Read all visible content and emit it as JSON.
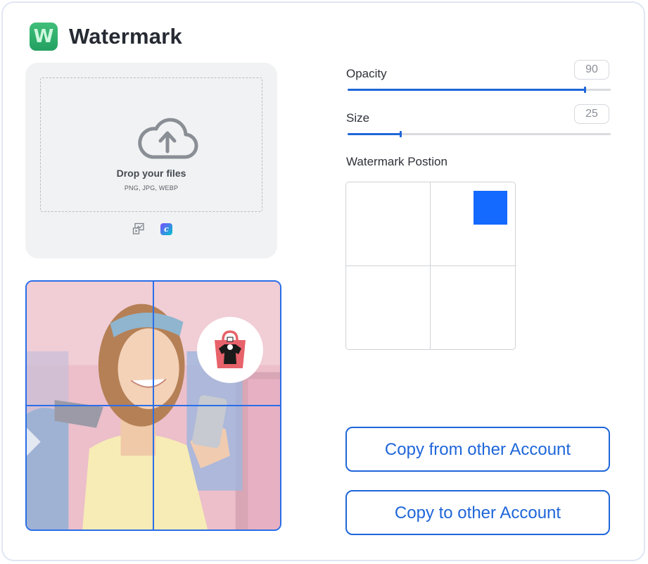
{
  "app": {
    "title": "Watermark",
    "logo_letter": "W",
    "logo_color": "#2eae6c"
  },
  "upload": {
    "title": "Drop your files",
    "formats": "PNG, JPG, WEBP",
    "icons": [
      "cloud-upload-icon",
      "media-library-icon",
      "canva-icon"
    ],
    "canva_letter": "c"
  },
  "preview": {
    "accent": "#2a6ee8"
  },
  "opacity": {
    "label": "Opacity",
    "value": "90",
    "fraction": 0.9
  },
  "size": {
    "label": "Size",
    "value": "25",
    "fraction": 0.2
  },
  "position": {
    "label": "Watermark Postion",
    "selected": "top-right",
    "marker_color": "#1469ff"
  },
  "actions": {
    "copy_from": "Copy from other Account",
    "copy_to": "Copy to other Account"
  }
}
